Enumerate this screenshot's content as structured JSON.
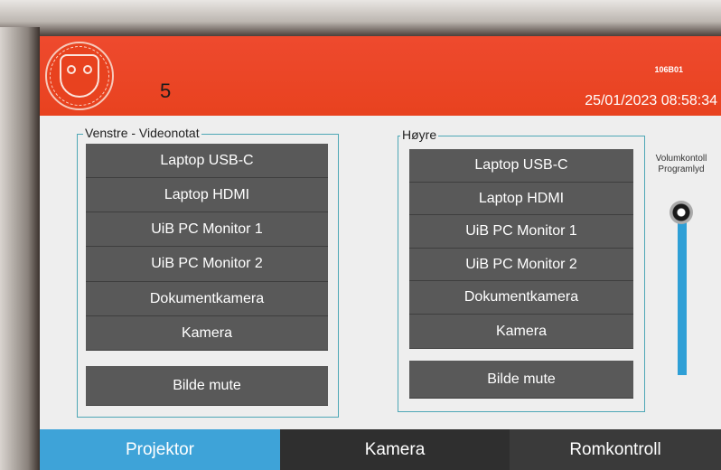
{
  "header": {
    "room_number": "5",
    "room_code": "106B01",
    "datetime": "25/01/2023 08:58:34"
  },
  "left_group": {
    "title": "Venstre - Videonotat",
    "sources": [
      "Laptop USB-C",
      "Laptop HDMI",
      "UiB PC Monitor 1",
      "UiB PC Monitor 2",
      "Dokumentkamera",
      "Kamera"
    ],
    "mute_label": "Bilde mute"
  },
  "right_group": {
    "title": "Høyre",
    "sources": [
      "Laptop USB-C",
      "Laptop HDMI",
      "UiB PC Monitor 1",
      "UiB PC Monitor 2",
      "Dokumentkamera",
      "Kamera"
    ],
    "mute_label": "Bilde mute"
  },
  "volume": {
    "label_line1": "Volumkontoll",
    "label_line2": "Programlyd",
    "level": 0.95
  },
  "tabs": {
    "projektor": "Projektor",
    "kamera": "Kamera",
    "romkontroll": "Romkontroll"
  },
  "colors": {
    "header_red": "#e8421f",
    "active_tab": "#3ea3d8",
    "button_gray": "#595959",
    "group_border": "#4ea7b6",
    "volume_track": "#2e9fd6"
  },
  "icons": {
    "logo": "university-seal-icon",
    "volume_knob": "slider-knob-icon"
  }
}
